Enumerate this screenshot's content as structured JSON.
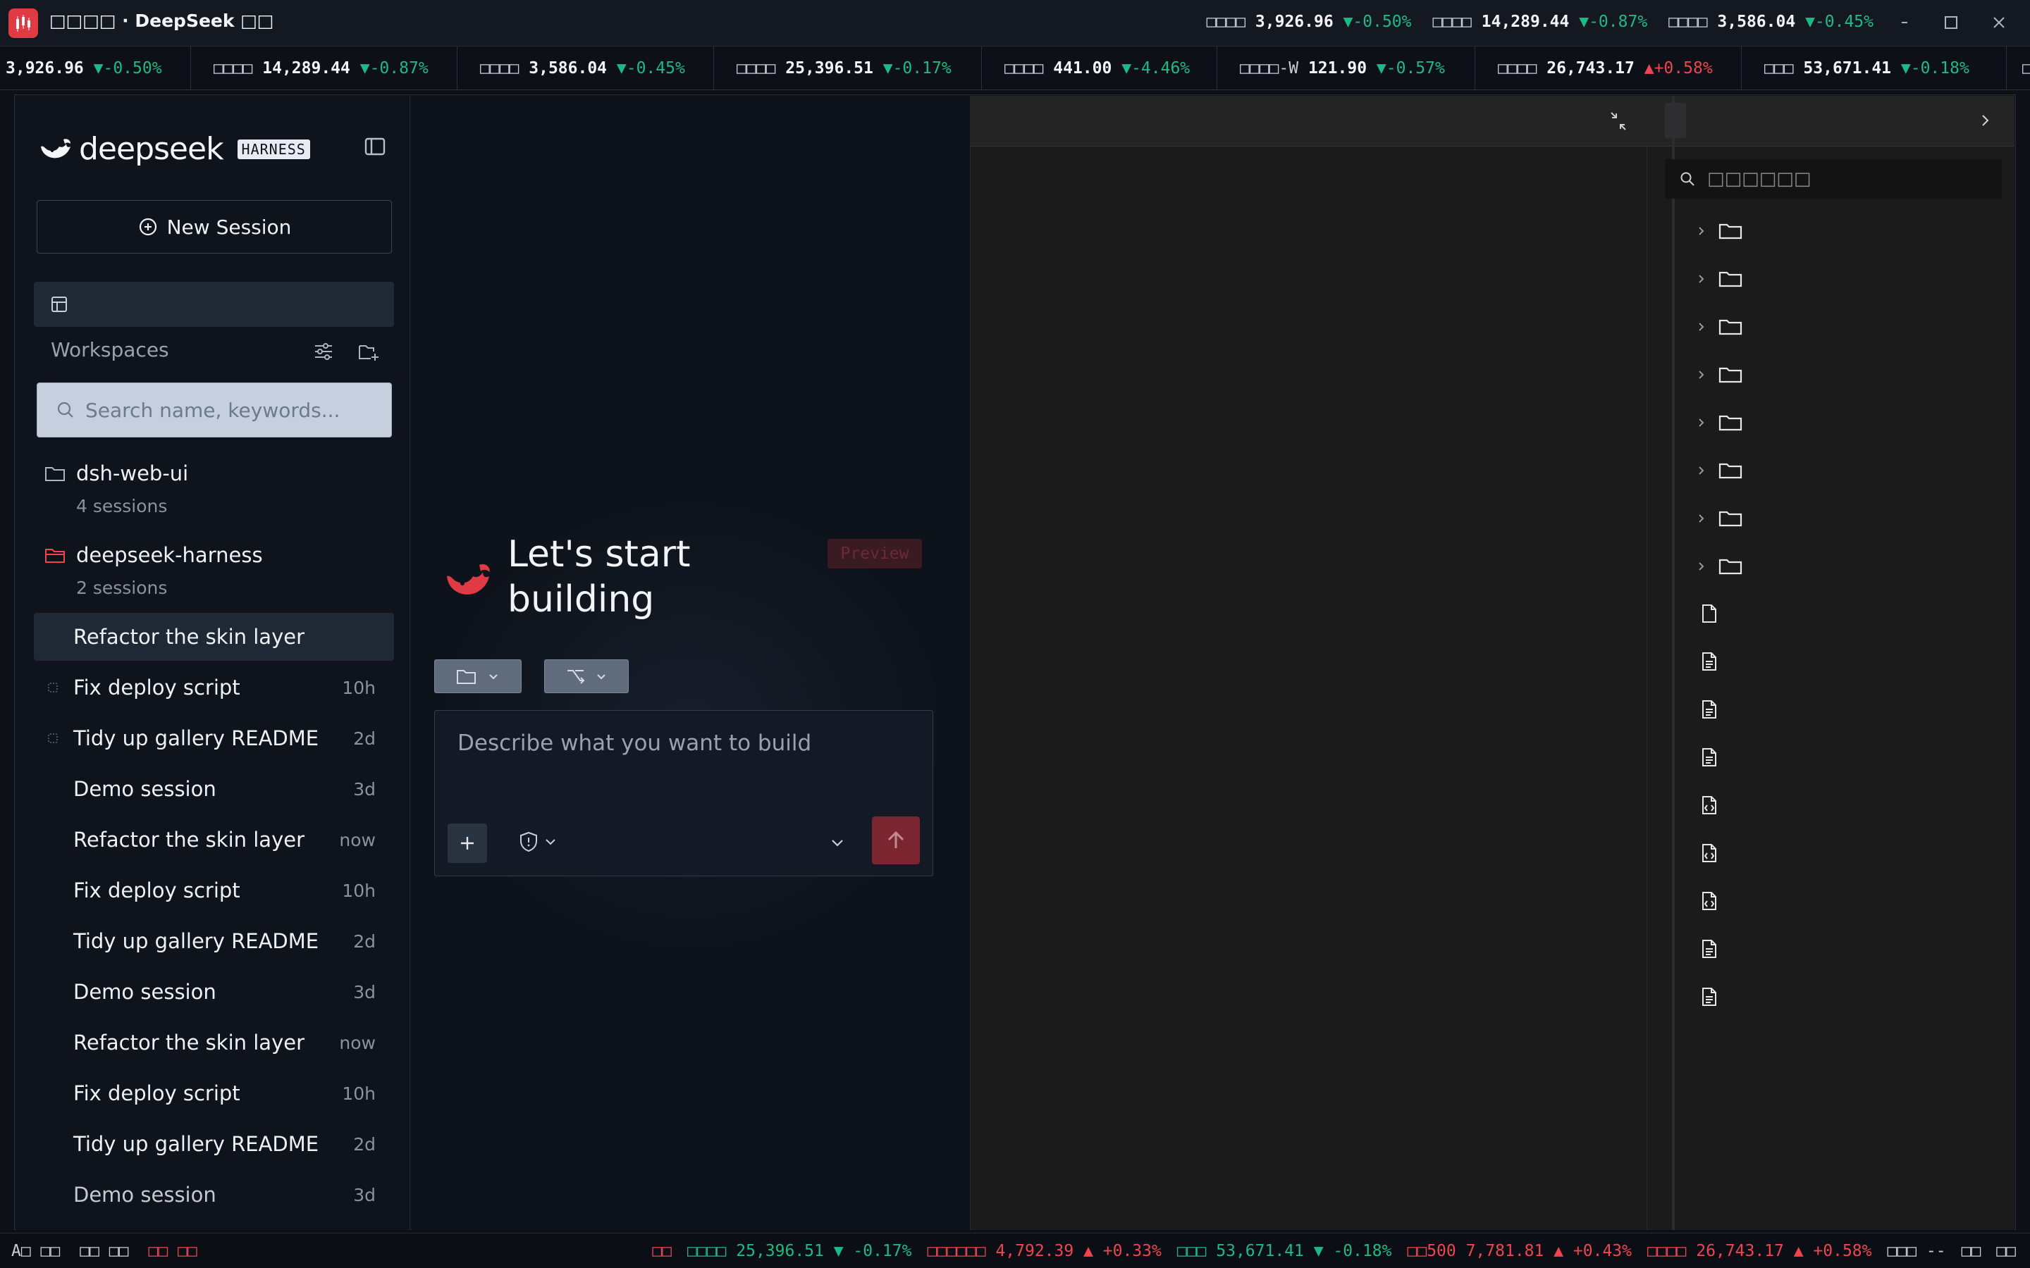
{
  "window": {
    "title": "□□□□ · DeepSeek □□",
    "tickers": [
      {
        "name": "□□□□",
        "value": "3,926.96",
        "change": "▼-0.50%",
        "dir": "down"
      },
      {
        "name": "□□□□",
        "value": "14,289.44",
        "change": "▼-0.87%",
        "dir": "down"
      },
      {
        "name": "□□□□",
        "value": "3,586.04",
        "change": "▼-0.45%",
        "dir": "down"
      }
    ],
    "controls": {
      "minimize": "–",
      "maximize": "☐",
      "close": "✕"
    }
  },
  "ticker_strip": [
    {
      "name": "",
      "value": "3,926.96",
      "change": "▼-0.50%",
      "dir": "down"
    },
    {
      "name": "□□□□",
      "value": "14,289.44",
      "change": "▼-0.87%",
      "dir": "down"
    },
    {
      "name": "□□□□",
      "value": "3,586.04",
      "change": "▼-0.45%",
      "dir": "down"
    },
    {
      "name": "□□□□",
      "value": "25,396.51",
      "change": "▼-0.17%",
      "dir": "down"
    },
    {
      "name": "□□□□",
      "value": "441.00",
      "change": "▼-4.46%",
      "dir": "down"
    },
    {
      "name": "□□□□-W",
      "value": "121.90",
      "change": "▼-0.57%",
      "dir": "down"
    },
    {
      "name": "□□□□",
      "value": "26,743.17",
      "change": "▲+0.58%",
      "dir": "up"
    },
    {
      "name": "□□□",
      "value": "53,671.41",
      "change": "▼-0.18%",
      "dir": "down"
    }
  ],
  "sidebar": {
    "brand": "deepseek",
    "badge": "HARNESS",
    "new_session": "New Session",
    "workspaces_label": "Workspaces",
    "search_placeholder": "Search name, keywords...",
    "workspaces": [
      {
        "name": "dsh-web-ui",
        "count": "4 sessions"
      },
      {
        "name": "deepseek-harness",
        "count": "2 sessions"
      }
    ],
    "sessions": [
      {
        "title": "Refactor the skin layer",
        "time": ""
      },
      {
        "title": "Fix deploy script",
        "time": "10h"
      },
      {
        "title": "Tidy up gallery README",
        "time": "2d"
      },
      {
        "title": "Demo session",
        "time": "3d"
      },
      {
        "title": "Refactor the skin layer",
        "time": "now"
      },
      {
        "title": "Fix deploy script",
        "time": "10h"
      },
      {
        "title": "Tidy up gallery README",
        "time": "2d"
      },
      {
        "title": "Demo session",
        "time": "3d"
      },
      {
        "title": "Refactor the skin layer",
        "time": "now"
      },
      {
        "title": "Fix deploy script",
        "time": "10h"
      },
      {
        "title": "Tidy up gallery README",
        "time": "2d"
      },
      {
        "title": "Demo session",
        "time": "3d"
      }
    ]
  },
  "main": {
    "hero_title": "Let's start building",
    "preview_tag": "Preview",
    "composer_placeholder": "Describe what you want to build"
  },
  "file_tree": {
    "search_placeholder": "□□□□□□",
    "folders": 8,
    "files": [
      "doc",
      "doc-lines",
      "doc-lines",
      "doc-lines",
      "doc-code",
      "doc-code",
      "doc-code",
      "doc-lines",
      "doc-lines"
    ]
  },
  "statusbar": {
    "left": [
      "A□ □□",
      "□□ □□",
      "□□ □□"
    ],
    "right": [
      {
        "text": "□□",
        "dir": "up"
      },
      {
        "text": "□□□□ 25,396.51 ▼ -0.17%",
        "dir": "down"
      },
      {
        "text": "□□□□□□ 4,792.39 ▲ +0.33%",
        "dir": "up"
      },
      {
        "text": "□□□ 53,671.41 ▼ -0.18%",
        "dir": "down"
      },
      {
        "text": "□□500 7,781.81 ▲ +0.43%",
        "dir": "up"
      },
      {
        "text": "□□□□ 26,743.17 ▲ +0.58%",
        "dir": "up"
      },
      {
        "text": "□□□ --",
        "dir": "neutral"
      },
      {
        "text": "□□",
        "dir": "neutral"
      },
      {
        "text": "□□",
        "dir": "neutral"
      }
    ]
  },
  "colors": {
    "accent": "#e03a45",
    "down": "#1fb985",
    "up": "#f0444f"
  }
}
